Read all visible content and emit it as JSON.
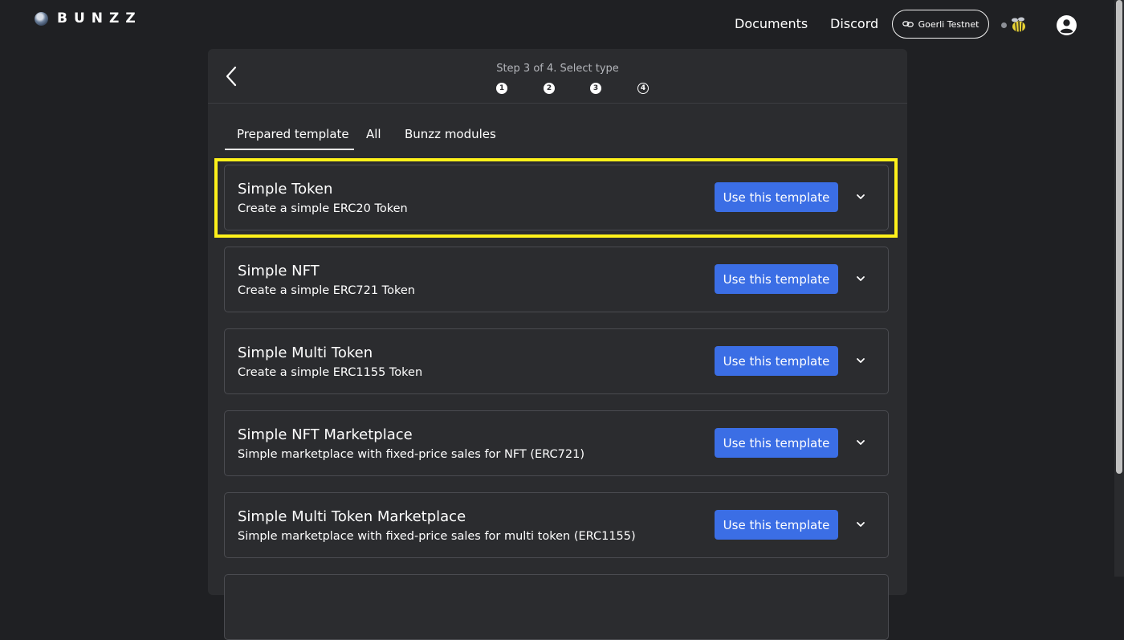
{
  "header": {
    "logo_text": "BUNZZ",
    "nav": [
      "Documents",
      "Discord"
    ],
    "network_label": "Goerli Testnet"
  },
  "stepper": {
    "title": "Step 3 of 4. Select type",
    "steps": [
      "1",
      "2",
      "3",
      "4"
    ],
    "current": 3
  },
  "tabs": [
    "Prepared template",
    "All",
    "Bunzz modules"
  ],
  "active_tab": "Prepared template",
  "templates": [
    {
      "title": "Simple Token",
      "description": "Create a simple ERC20 Token",
      "button": "Use this template",
      "highlighted": true
    },
    {
      "title": "Simple NFT",
      "description": "Create a simple ERC721 Token",
      "button": "Use this template"
    },
    {
      "title": "Simple Multi Token",
      "description": "Create a simple ERC1155 Token",
      "button": "Use this template"
    },
    {
      "title": "Simple NFT Marketplace",
      "description": "Simple marketplace with fixed-price sales for NFT (ERC721)",
      "button": "Use this template"
    },
    {
      "title": "Simple Multi Token Marketplace",
      "description": "Simple marketplace with fixed-price sales for multi token (ERC1155)",
      "button": "Use this template"
    }
  ],
  "colors": {
    "background": "#1f2023",
    "panel": "#2b2c2f",
    "primary_button": "#3b6ee5",
    "highlight": "#fff11a"
  }
}
